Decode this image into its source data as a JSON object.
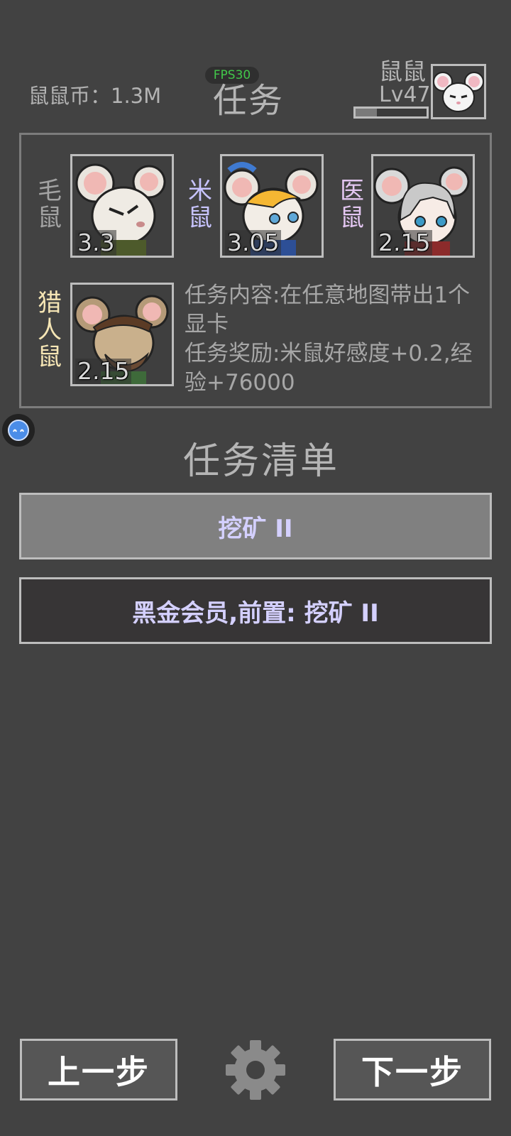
{
  "header": {
    "coins": "鼠鼠币：1.3M",
    "fps": "FPS30",
    "title": "任务",
    "player_name": "鼠鼠",
    "player_level": "Lv47",
    "xp_fraction": 0.3
  },
  "crew": [
    {
      "name": "毛\n鼠",
      "score": "3.3",
      "name_color": "#a3a3a3"
    },
    {
      "name": "米\n鼠",
      "score": "3.05",
      "name_color": "#c8c4ff"
    },
    {
      "name": "医\n鼠",
      "score": "2.15",
      "name_color": "#e3c6f1"
    },
    {
      "name": "猎\n人\n鼠",
      "score": "2.15",
      "name_color": "#f6e6b5"
    }
  ],
  "task": {
    "content": "任务内容:在任意地图带出1个显卡",
    "reward": "任务奖励:米鼠好感度+0.2,经验+76000"
  },
  "list": {
    "title": "任务清单",
    "items": [
      "挖矿 II",
      "黑金会员,前置: 挖矿 II"
    ]
  },
  "nav": {
    "prev": "上一步",
    "next": "下一步"
  }
}
